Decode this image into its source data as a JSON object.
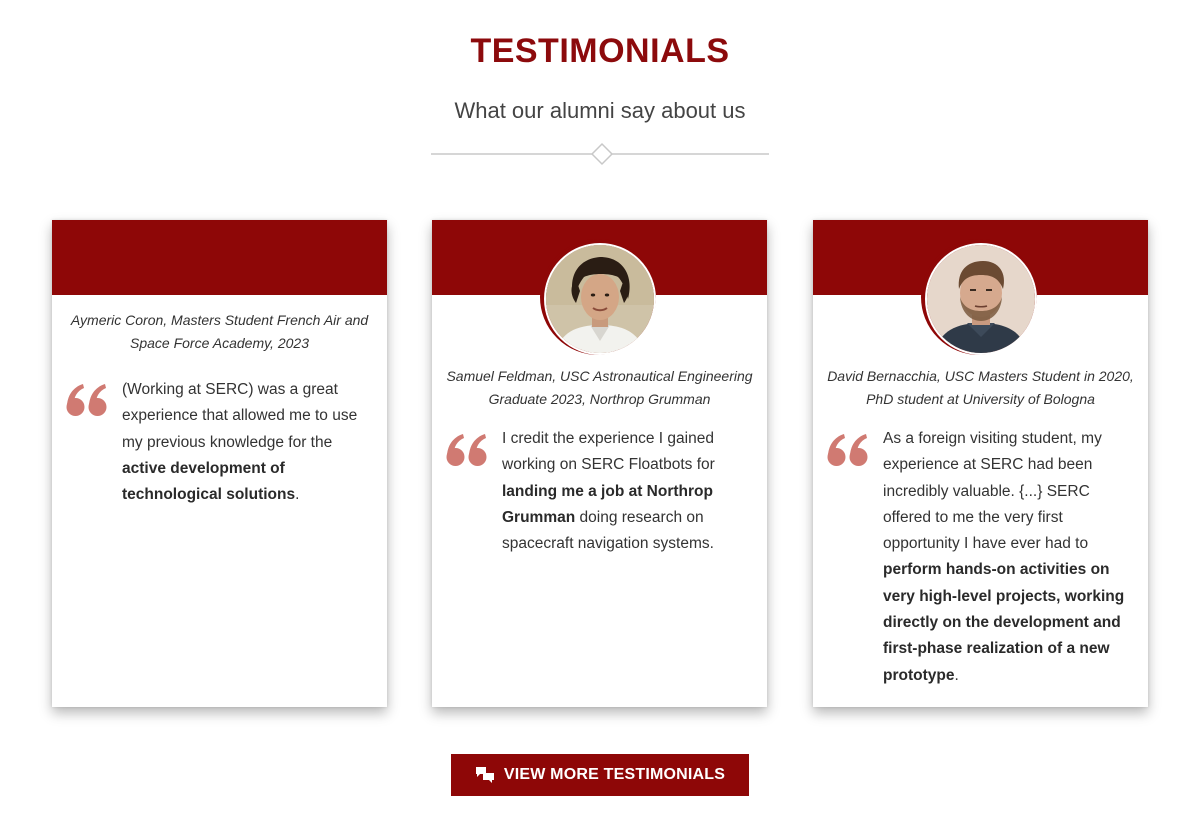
{
  "header": {
    "title": "TESTIMONIALS",
    "subtitle": "What our alumni say about us"
  },
  "testimonials": [
    {
      "author": "Aymeric Coron, Masters Student French Air and Space Force Academy, 2023",
      "has_photo": false,
      "quote": [
        {
          "t": "(Working at SERC) was a great experience that allowed me to use my previous knowledge for the ",
          "b": false
        },
        {
          "t": "active development of technological solutions",
          "b": true
        },
        {
          "t": ".",
          "b": false
        }
      ]
    },
    {
      "author": "Samuel Feldman, USC Astronautical Engineering Graduate 2023, Northrop Grumman",
      "has_photo": true,
      "quote": [
        {
          "t": "I credit the experience I gained working on SERC Floatbots for ",
          "b": false
        },
        {
          "t": "landing me a job at Northrop Grumman",
          "b": true
        },
        {
          "t": " doing research on spacecraft navigation systems.",
          "b": false
        }
      ]
    },
    {
      "author": "David Bernacchia, USC Masters Student in 2020, PhD student at University of Bologna",
      "has_photo": true,
      "quote": [
        {
          "t": "As a foreign visiting student, my experience at SERC had been incredibly valuable. {...} SERC offered to me the very first opportunity I have ever had to ",
          "b": false
        },
        {
          "t": "perform hands-on activities on very high-level projects, working directly on the development and first-phase realization of a new prototype",
          "b": true
        },
        {
          "t": ".",
          "b": false
        }
      ]
    }
  ],
  "button": {
    "label": "VIEW MORE TESTIMONIALS",
    "icon": "chat-bubbles-icon"
  },
  "colors": {
    "brand_red": "#8e0707",
    "quote_mark": "#d07a72",
    "text": "#333333"
  }
}
